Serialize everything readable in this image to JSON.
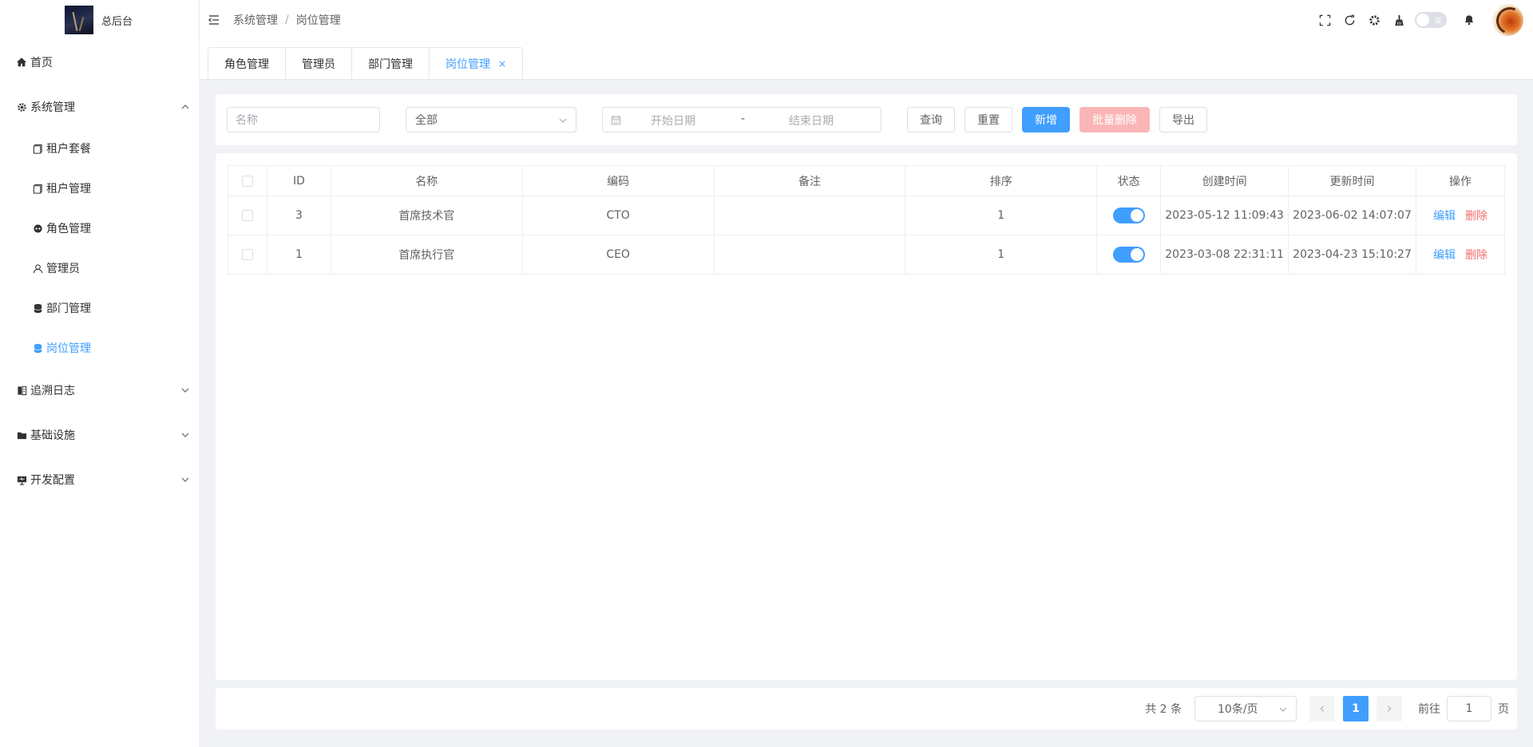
{
  "app": {
    "title": "总后台"
  },
  "sidebar": {
    "items": [
      {
        "label": "首页",
        "icon": "home-icon"
      },
      {
        "label": "系统管理",
        "icon": "gear-icon",
        "expanded": true
      },
      {
        "label": "租户套餐",
        "icon": "document-icon"
      },
      {
        "label": "租户管理",
        "icon": "document-icon"
      },
      {
        "label": "角色管理",
        "icon": "user-mask-icon"
      },
      {
        "label": "管理员",
        "icon": "user-icon"
      },
      {
        "label": "部门管理",
        "icon": "database-icon"
      },
      {
        "label": "岗位管理",
        "icon": "database-icon",
        "active": true
      },
      {
        "label": "追溯日志",
        "icon": "log-icon"
      },
      {
        "label": "基础设施",
        "icon": "folder-icon"
      },
      {
        "label": "开发配置",
        "icon": "monitor-icon"
      }
    ]
  },
  "header": {
    "breadcrumb": [
      "系统管理",
      "岗位管理"
    ],
    "breadcrumb_sep": "/",
    "dark_toggle_label": "关"
  },
  "tabs": [
    {
      "label": "角色管理"
    },
    {
      "label": "管理员"
    },
    {
      "label": "部门管理"
    },
    {
      "label": "岗位管理",
      "active": true,
      "close": "×"
    }
  ],
  "search": {
    "name_placeholder": "名称",
    "status_value": "全部",
    "start_placeholder": "开始日期",
    "range_sep": "-",
    "end_placeholder": "结束日期",
    "query_label": "查询",
    "reset_label": "重置",
    "add_label": "新增",
    "batch_delete_label": "批量删除",
    "export_label": "导出"
  },
  "table": {
    "columns": [
      "ID",
      "名称",
      "编码",
      "备注",
      "排序",
      "状态",
      "创建时间",
      "更新时间",
      "操作"
    ],
    "rows": [
      {
        "id": "3",
        "name": "首席技术官",
        "code": "CTO",
        "remark": "",
        "sort": "1",
        "status_on": true,
        "created": "2023-05-12 11:09:43",
        "updated": "2023-06-02 14:07:07",
        "edit": "编辑",
        "delete": "删除"
      },
      {
        "id": "1",
        "name": "首席执行官",
        "code": "CEO",
        "remark": "",
        "sort": "1",
        "status_on": true,
        "created": "2023-03-08 22:31:11",
        "updated": "2023-04-23 15:10:27",
        "edit": "编辑",
        "delete": "删除"
      }
    ]
  },
  "pagination": {
    "total_text": "共 2 条",
    "page_size": "10条/页",
    "current_page": "1",
    "goto_label": "前往",
    "goto_value": "1",
    "page_suffix": "页"
  },
  "colors": {
    "primary": "#409eff",
    "danger": "#f56c6c",
    "danger_disabled": "#fab6b6",
    "page_bg": "#f0f2f5"
  }
}
